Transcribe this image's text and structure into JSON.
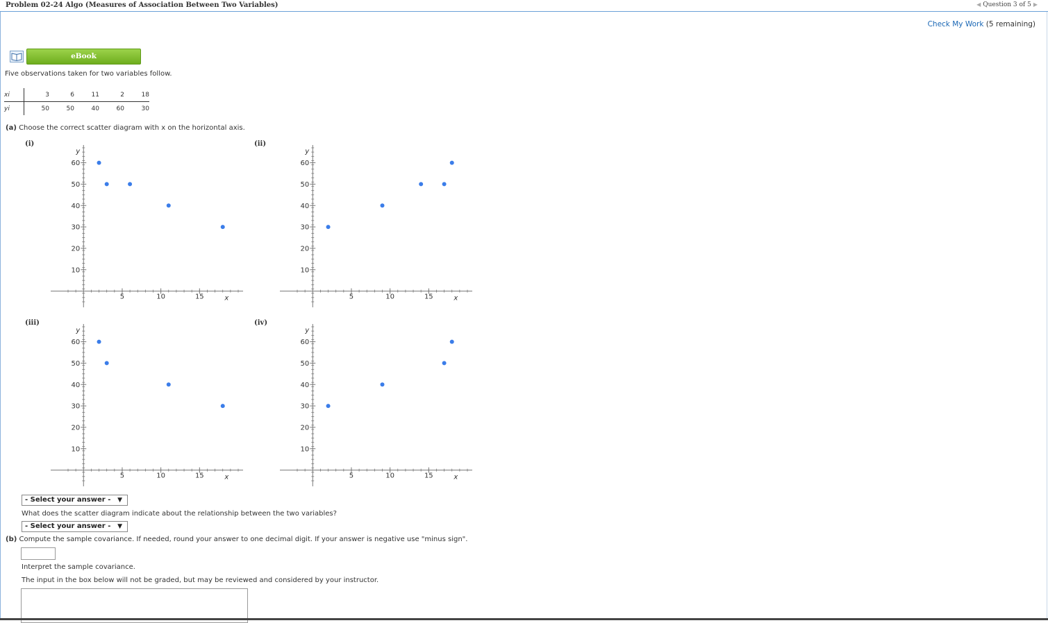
{
  "header": {
    "problem_title": "Problem 02-24 Algo (Measures of Association Between Two Variables)",
    "question_nav": "Question 3 of 5",
    "check_my_work": "Check My Work",
    "remaining": "(5 remaining)"
  },
  "ebook": {
    "label": "eBook"
  },
  "intro": "Five observations taken for two variables follow.",
  "observations": {
    "x_label": "xi",
    "y_label": "yi",
    "x": [
      "3",
      "6",
      "11",
      "2",
      "18"
    ],
    "y": [
      "50",
      "50",
      "40",
      "60",
      "30"
    ]
  },
  "part_a": {
    "tag": "(a)",
    "text": "Choose the correct scatter diagram with x on the horizontal axis.",
    "select1": "- Select your answer -",
    "question2": "What does the scatter diagram indicate about the relationship between the two variables?",
    "select2": "- Select your answer -"
  },
  "part_b": {
    "tag": "(b)",
    "text": "Compute the sample covariance. If needed, round your answer to one decimal digit. If your answer is negative use \"minus sign\".",
    "interpret": "Interpret the sample covariance.",
    "note": "The input in the box below will not be graded, but may be reviewed and considered by your instructor."
  },
  "chart_data": [
    {
      "type": "scatter",
      "label": "(i)",
      "xlabel": "x",
      "ylabel": "y",
      "xlim": [
        -2,
        20
      ],
      "ylim": [
        -5,
        67
      ],
      "xticks": [
        5,
        10,
        15
      ],
      "yticks": [
        10,
        20,
        30,
        40,
        50,
        60
      ],
      "points": [
        [
          2,
          60
        ],
        [
          3,
          50
        ],
        [
          6,
          50
        ],
        [
          11,
          40
        ],
        [
          18,
          30
        ]
      ]
    },
    {
      "type": "scatter",
      "label": "(ii)",
      "xlabel": "x",
      "ylabel": "y",
      "xlim": [
        -2,
        20
      ],
      "ylim": [
        -5,
        67
      ],
      "xticks": [
        5,
        10,
        15
      ],
      "yticks": [
        10,
        20,
        30,
        40,
        50,
        60
      ],
      "points": [
        [
          2,
          30
        ],
        [
          9,
          40
        ],
        [
          14,
          50
        ],
        [
          17,
          50
        ],
        [
          18,
          60
        ]
      ]
    },
    {
      "type": "scatter",
      "label": "(iii)",
      "xlabel": "x",
      "ylabel": "y",
      "xlim": [
        -2,
        20
      ],
      "ylim": [
        -5,
        67
      ],
      "xticks": [
        5,
        10,
        15
      ],
      "yticks": [
        10,
        20,
        30,
        40,
        50,
        60
      ],
      "points": [
        [
          2,
          60
        ],
        [
          3,
          50
        ],
        [
          11,
          40
        ],
        [
          18,
          30
        ]
      ]
    },
    {
      "type": "scatter",
      "label": "(iv)",
      "xlabel": "x",
      "ylabel": "y",
      "xlim": [
        -2,
        20
      ],
      "ylim": [
        -5,
        67
      ],
      "xticks": [
        5,
        10,
        15
      ],
      "yticks": [
        10,
        20,
        30,
        40,
        50,
        60
      ],
      "points": [
        [
          2,
          30
        ],
        [
          9,
          40
        ],
        [
          17,
          50
        ],
        [
          18,
          60
        ]
      ]
    }
  ],
  "colors": {
    "point": "#3b7de9",
    "link": "#1a67b5",
    "ebook": "#7fbf2f",
    "topline": "#6aa0d8"
  }
}
